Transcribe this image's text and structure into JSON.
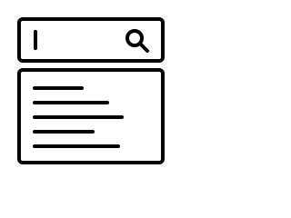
{
  "icons": {
    "search": "search-icon",
    "caret": "text-caret"
  },
  "colors": {
    "stroke": "#000000",
    "background": "#ffffff"
  },
  "search": {
    "value": "",
    "placeholder": ""
  },
  "results": {
    "line_count": 5
  }
}
